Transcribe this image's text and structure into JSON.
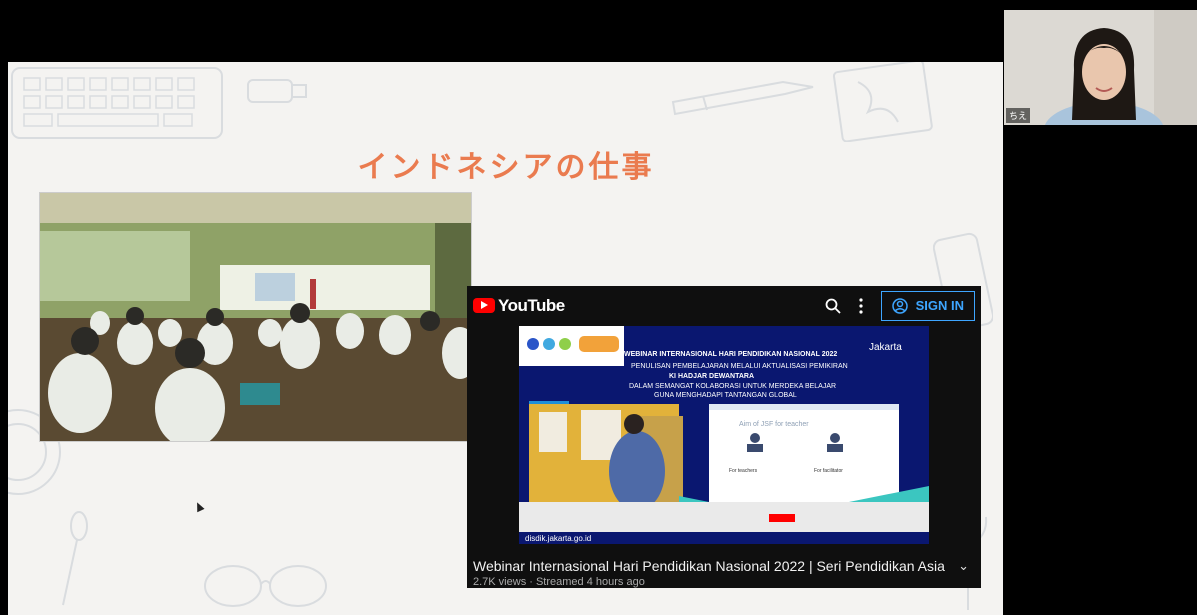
{
  "slide": {
    "title": "インドネシアの仕事"
  },
  "youtube": {
    "brand": "YouTube",
    "sign_in": "SIGN IN",
    "video_title": "Webinar Internasional Hari Pendidikan Nasional 2022 | Seri Pendidikan Asia",
    "video_meta": "2.7K views · Streamed 4 hours ago",
    "banner": {
      "line1": "WEBINAR INTERNASIONAL HARI PENDIDIKAN NASIONAL 2022",
      "line2": "PENULISAN PEMBELAJARAN MELALUI AKTUALISASI PEMIKIRAN",
      "line3": "KI HADJAR DEWANTARA",
      "line4": "DALAM SEMANGAT KOLABORASI UNTUK MERDEKA BELAJAR",
      "line5": "GUNA MENGHADAPI TANTANGAN GLOBAL",
      "city": "Jakarta",
      "slide_heading": "Aim of JSF for teacher",
      "slide_left": "For teachers",
      "slide_right": "For facilitator",
      "site": "disdik.jakarta.go.id"
    }
  },
  "participant": {
    "name": "ちえ"
  },
  "colors": {
    "title": "#ea7b4f",
    "youtube_red": "#ff0000",
    "signin_blue": "#3ea6ff"
  }
}
